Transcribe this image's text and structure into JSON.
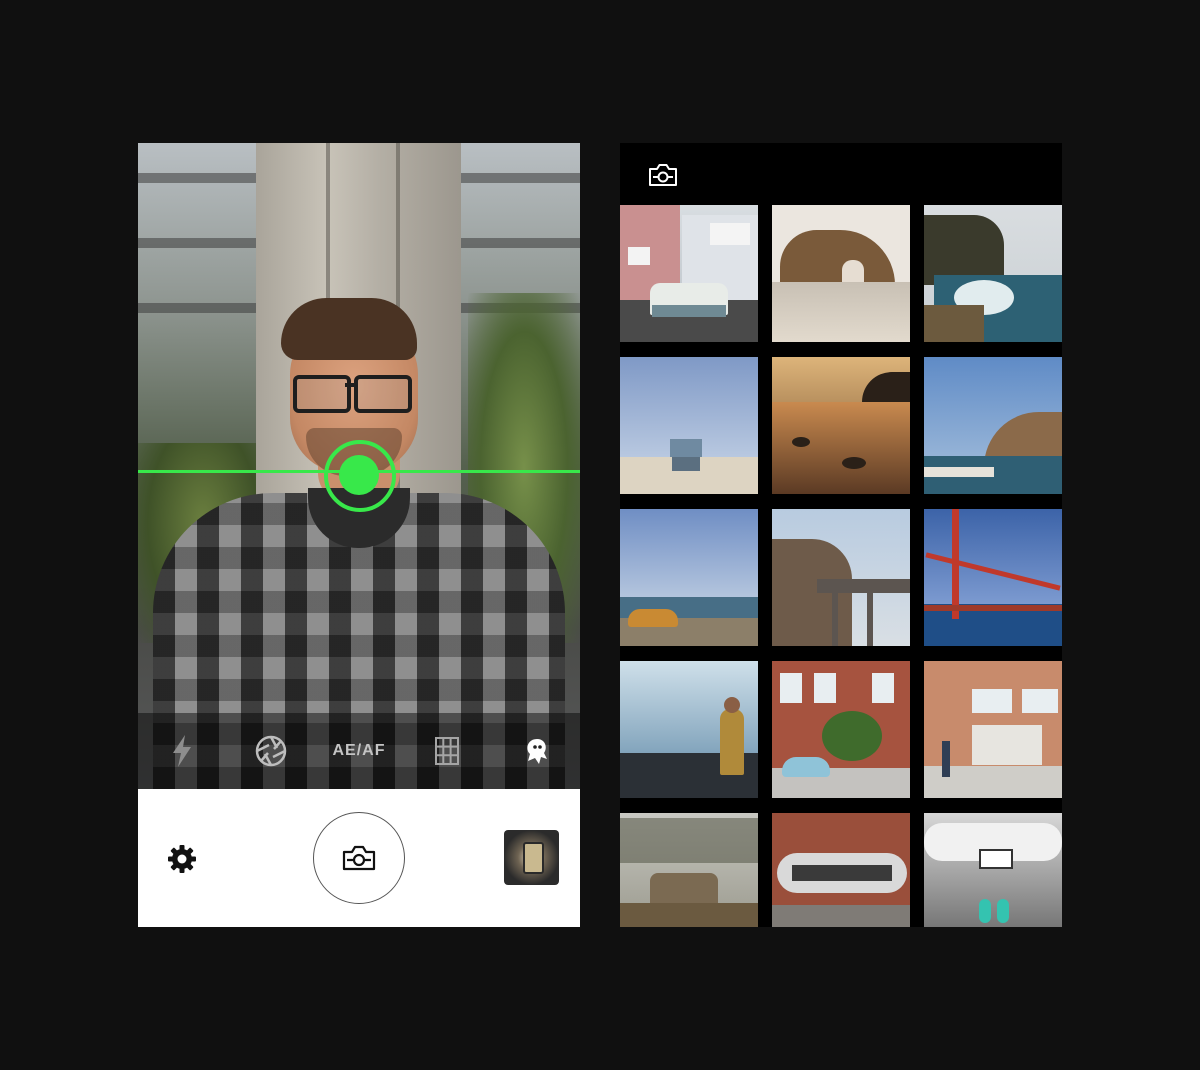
{
  "camera_screen": {
    "toolbar": {
      "flash_icon": "lightning-bolt",
      "aperture_icon": "aperture",
      "ae_af_label": "AE/AF",
      "grid_icon": "grid",
      "ghost_icon": "ghost"
    },
    "bottom": {
      "settings_icon": "gear",
      "shutter_icon": "camera",
      "last_photo": "lantern-thumbnail"
    },
    "colors": {
      "level_accent": "#38e84a",
      "panel": "#ffffff"
    }
  },
  "gallery_screen": {
    "header_icon": "camera",
    "photos": [
      {
        "subject": "van-and-victorian-houses"
      },
      {
        "subject": "rock-arch-beach"
      },
      {
        "subject": "coastal-cove"
      },
      {
        "subject": "lifeguard-tower"
      },
      {
        "subject": "sunset-tidepools"
      },
      {
        "subject": "coastal-cliffs"
      },
      {
        "subject": "orange-car-coast"
      },
      {
        "subject": "bixby-bridge"
      },
      {
        "subject": "golden-gate-bridge"
      },
      {
        "subject": "man-on-rocks-ocean"
      },
      {
        "subject": "beetle-brick-house"
      },
      {
        "subject": "pink-house-street"
      },
      {
        "subject": "vintage-truck"
      },
      {
        "subject": "alligator-mural"
      },
      {
        "subject": "sneakers-below-sign"
      }
    ]
  }
}
